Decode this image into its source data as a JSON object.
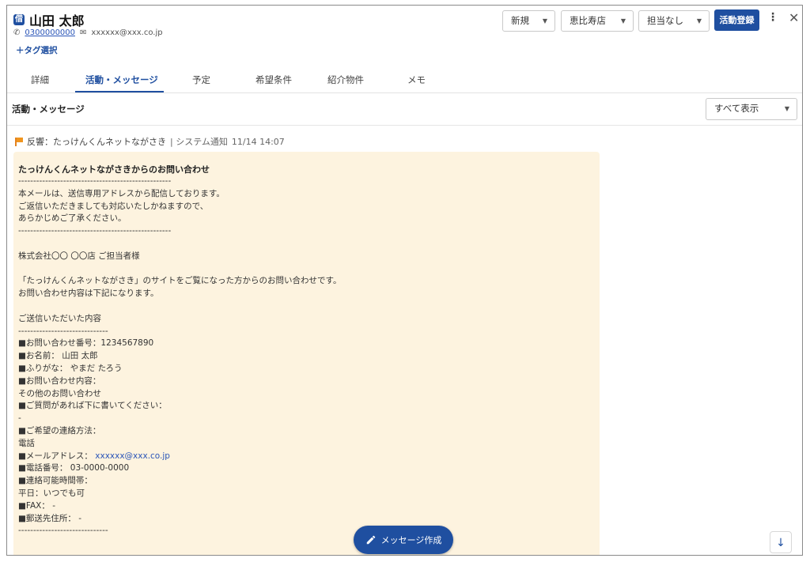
{
  "header": {
    "badge": "借",
    "name": "山田 太郎",
    "phone_icon": "phone-icon",
    "phone": "0300000000",
    "mail_icon": "mail-icon",
    "email": "xxxxxx@xxx.co.jp",
    "tag_select": "＋タグ選択"
  },
  "toolbar": {
    "status": "新規",
    "store": "恵比寿店",
    "assignee": "担当なし",
    "register_label": "活動登録",
    "more_icon": "more-vertical-icon",
    "close_icon": "close-icon"
  },
  "tabs": [
    {
      "label": "詳細",
      "active": false
    },
    {
      "label": "活動・メッセージ",
      "active": true
    },
    {
      "label": "予定",
      "active": false
    },
    {
      "label": "希望条件",
      "active": false
    },
    {
      "label": "紹介物件",
      "active": false
    },
    {
      "label": "メモ",
      "active": false
    }
  ],
  "section": {
    "title": "活動・メッセージ",
    "filter": "すべて表示"
  },
  "activity": {
    "type_icon": "flag-icon",
    "label": "反響：たっけんくんネットながさき",
    "source": "| システム通知",
    "datetime": "11/14 14:07"
  },
  "message": {
    "title": "たっけんくんネットながさきからのお問い合わせ",
    "lines": [
      "---------------------------------------------------",
      "本メールは、送信専用アドレスから配信しております。",
      "ご返信いただきましても対応いたしかねますので、",
      "あらかじめご了承ください。",
      "---------------------------------------------------",
      "",
      "株式会社〇〇 〇〇店 ご担当者様",
      "",
      "「たっけんくんネットながさき」のサイトをご覧になった方からのお問い合わせです。",
      "お問い合わせ内容は下記になります。",
      "",
      "ご送信いただいた内容",
      "------------------------------",
      "■お問い合わせ番号：1234567890",
      "■お名前： 山田 太郎",
      "■ふりがな： やまだ たろう",
      "■お問い合わせ内容：",
      "その他のお問い合わせ",
      "■ご質問があれば下に書いてください：",
      "-",
      "■ご希望の連絡方法：",
      "電話",
      "■メールアドレス：",
      "■電話番号： 03-0000-0000",
      "■連絡可能時間帯：",
      "平日：いつでも可",
      "■FAX： -",
      "■郵送先住所： -",
      "------------------------------"
    ],
    "mail_address": "xxxxxx@xxx.co.jp"
  },
  "compose": {
    "icon": "pencil-icon",
    "label": "メッセージ作成"
  },
  "scroll": {
    "icon": "arrow-down-icon",
    "glyph": "↓"
  }
}
